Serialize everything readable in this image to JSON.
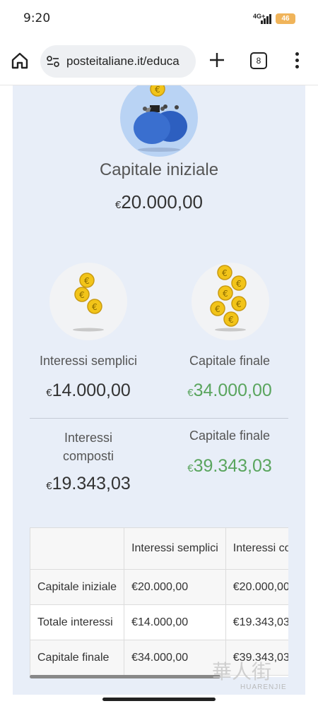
{
  "status_bar": {
    "time": "9:20",
    "network": "4G+",
    "battery": "46"
  },
  "browser": {
    "url": "posteitaliane.it/educa",
    "tab_count": "8"
  },
  "summary": {
    "initial_capital": {
      "label": "Capitale iniziale",
      "currency": "€",
      "value": "20.000,00"
    },
    "simple_interest": {
      "label": "Interessi semplici",
      "currency": "€",
      "value": "14.000,00"
    },
    "simple_final": {
      "label": "Capitale finale",
      "currency": "€",
      "value": "34.000,00"
    },
    "compound_interest": {
      "label_line1": "Interessi",
      "label_line2": "composti",
      "currency": "€",
      "value": "19.343,03"
    },
    "compound_final": {
      "label": "Capitale finale",
      "currency": "€",
      "value": "39.343,03"
    }
  },
  "table": {
    "headers": [
      "",
      "Interessi semplici",
      "Interessi composti"
    ],
    "rows": [
      [
        "Capitale iniziale",
        "€20.000,00",
        "€20.000,00"
      ],
      [
        "Totale interessi",
        "€14.000,00",
        "€19.343,03"
      ],
      [
        "Capitale finale",
        "€34.000,00",
        "€39.343,03"
      ]
    ]
  },
  "watermark": {
    "text": "華人街",
    "subtext": "HUARENJIE"
  },
  "colors": {
    "panel": "#e8eef8",
    "green": "#5aa55e",
    "wallet_blue": "#3a6fcf",
    "coin_gold": "#f2c419"
  }
}
